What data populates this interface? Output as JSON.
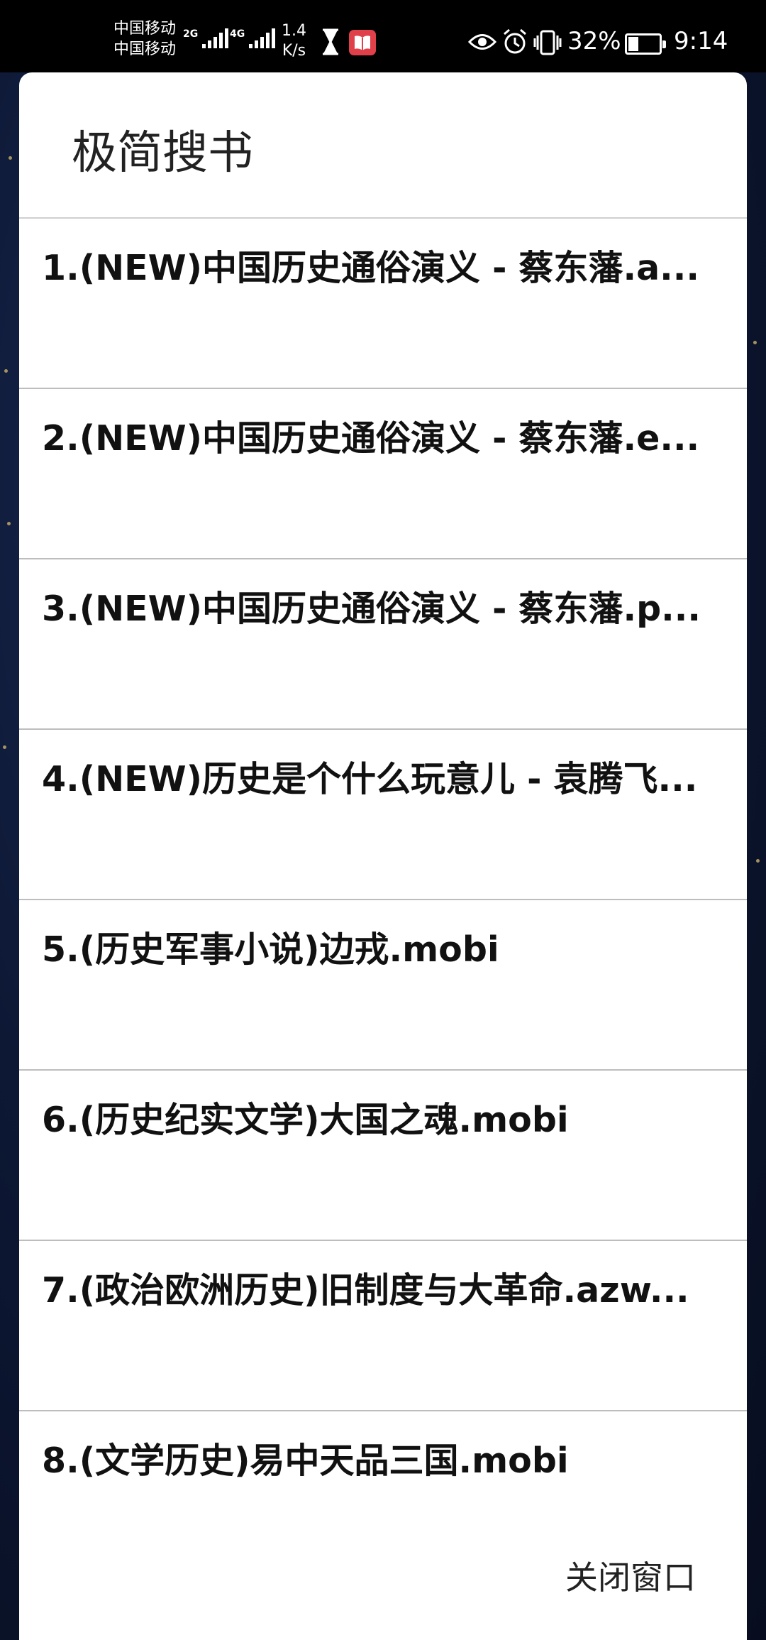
{
  "status_bar": {
    "carrier_1": "中国移动",
    "carrier_2": "中国移动",
    "net_1": "2G",
    "net_2": "4G",
    "speed_value": "1.4",
    "speed_unit": "K/s",
    "battery": "32%",
    "time": "9:14",
    "icons": [
      "hourglass-icon",
      "book-app-icon",
      "eye-icon",
      "alarm-icon",
      "vibrate-icon",
      "battery-icon"
    ]
  },
  "dialog": {
    "title": "极简搜书",
    "close_label": "关闭窗口",
    "items": [
      "1.(NEW)中国历史通俗演义 - 蔡东藩.a...",
      "2.(NEW)中国历史通俗演义 - 蔡东藩.e...",
      "3.(NEW)中国历史通俗演义 - 蔡东藩.p...",
      "4.(NEW)历史是个什么玩意儿 - 袁腾飞...",
      "5.(历史军事小说)边戎.mobi",
      "6.(历史纪实文学)大国之魂.mobi",
      "7.(政治欧洲历史)旧制度与大革命.azw...",
      "8.(文学历史)易中天品三国.mobi"
    ]
  }
}
